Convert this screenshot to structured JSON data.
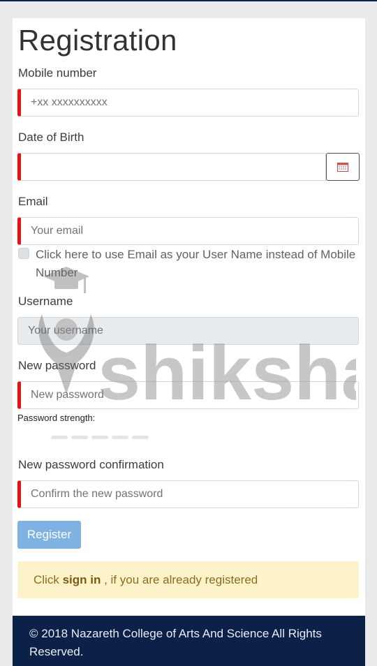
{
  "form": {
    "title": "Registration",
    "mobile": {
      "label": "Mobile number",
      "placeholder": "+xx xxxxxxxxxx"
    },
    "dob": {
      "label": "Date of Birth",
      "value": ""
    },
    "email": {
      "label": "Email",
      "placeholder": "Your email"
    },
    "use_email_checkbox": {
      "label": "Click here to use Email as your User Name instead of Mobile Number",
      "checked": false
    },
    "username": {
      "label": "Username",
      "placeholder": "Your username"
    },
    "new_password": {
      "label": "New password",
      "placeholder": "New password"
    },
    "strength": {
      "label": "Password strength:",
      "segments": 5
    },
    "confirm_password": {
      "label": "New password confirmation",
      "placeholder": "Confirm the new password"
    },
    "register_label": "Register"
  },
  "notice": {
    "prefix": "Click ",
    "link": "sign in",
    "suffix": " , if you are already registered"
  },
  "footer": {
    "text": "© 2018 Nazareth College of Arts And Science All Rights Reserved."
  },
  "watermark": {
    "text": "shiksha"
  },
  "icons": {
    "calendar": "calendar-icon"
  },
  "colors": {
    "required_marker": "#ee1010",
    "button": "#7fb2e0",
    "footer_bg": "#0c2147",
    "notice_bg": "#fdf3cb"
  }
}
